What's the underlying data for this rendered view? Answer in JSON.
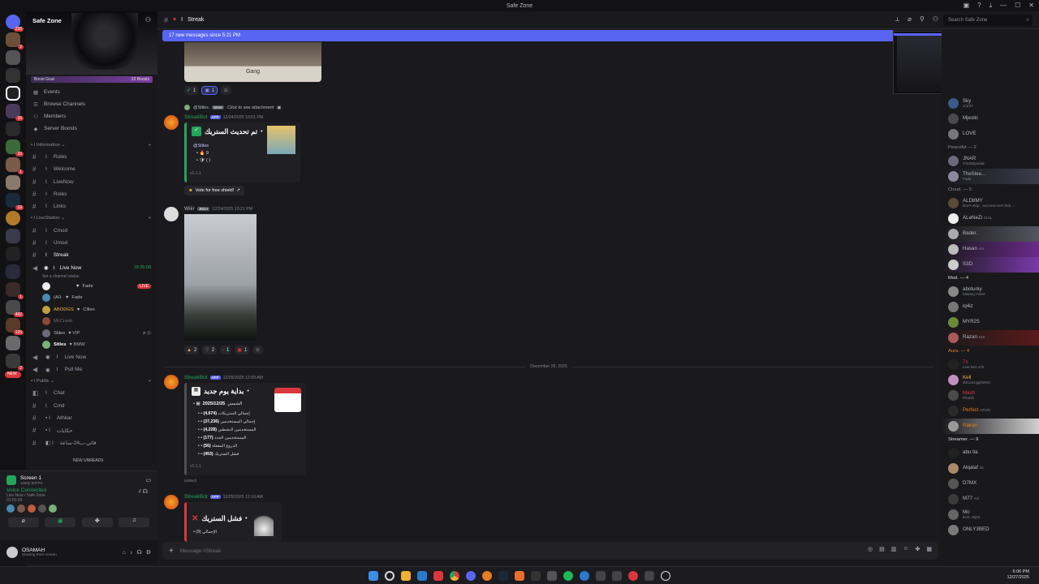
{
  "window": {
    "title": "Safe Zone"
  },
  "server": {
    "name": "Safe Zone",
    "boost_goal": "Boost Goal",
    "boost_count": "33 Boosts"
  },
  "rail_badges": [
    "238",
    "2",
    "16",
    "10",
    "1",
    "9",
    "19",
    "1",
    "492",
    "1",
    "126",
    "2",
    "NEW"
  ],
  "nav_items": [
    {
      "icon": "calendar-icon",
      "label": "Events"
    },
    {
      "icon": "browse-icon",
      "label": "Browse Channels"
    },
    {
      "icon": "members-icon",
      "label": "Members"
    },
    {
      "icon": "boost-icon",
      "label": "Server Boosts"
    }
  ],
  "categories": {
    "information": "Information",
    "livestation": "LiveStation",
    "public": "Public"
  },
  "info_channels": [
    "Rules",
    "Welcome",
    "LiveNow",
    "Roles",
    "Links"
  ],
  "live_channels": [
    "Cmod",
    "Umod",
    "Streak"
  ],
  "voice_live": {
    "name": "Live Now",
    "timer": "18:26:08",
    "status": "Set a channel status",
    "live_badge": "LIVE"
  },
  "voice_users": [
    "Fade",
    "Fade",
    "Clllen",
    "McCrash",
    "Stiles"
  ],
  "voice_users_names": [
    "ᅟ",
    "(A0-",
    "ABODGS",
    "Clllen",
    "McCrash"
  ],
  "voice_channels2": [
    "Live Now",
    "Pull Me"
  ],
  "public_channels": [
    "Chat",
    "Cmd",
    "Athkar",
    "حكايات",
    "قائي-ب24-ساعة"
  ],
  "new_unreads": "NEW UNREADS",
  "screen_share": {
    "title": "Screen 1",
    "sub": "1080p 60FPS"
  },
  "voice_connected": {
    "label": "Voice Connected",
    "channel": "Live Now / Safe Zone",
    "time": "01:50:39"
  },
  "user": {
    "name": "OSAMAH",
    "status": "Sharing their screen"
  },
  "header": {
    "channel": "Streak",
    "search_placeholder": "Search Safe Zone"
  },
  "new_messages_bar": "17 new messages since 5:21 PM",
  "messages": {
    "gang_caption": "Gang",
    "r1": [
      "1",
      "1"
    ],
    "reply_user": "@Stiles",
    "reply_tag": "BMW",
    "reply_text": "Click to see attachment",
    "streakbot": "StreakBot",
    "app_tag": "APP",
    "m1_time": "12/24/2025 10:01 PM",
    "m1_title": "تم تحديث الستريك",
    "m1_mention": "@Stiles",
    "m1_v1": "9",
    "m1_v2": "( )",
    "m1_ver": "v1.1.1",
    "vote": "Vote for free shield!",
    "wiiir": "Wiiir",
    "wiiir_tag": "JMLH",
    "wiiir_time": "12/24/2025 10:21 PM",
    "r2": [
      "2",
      "2",
      "1",
      "1"
    ],
    "date_divider": "December 25, 2025",
    "m2_time": "12/25/2025 12:00 AM",
    "m2_title": "بداية يوم جديد",
    "m2_date": "2025/12/25",
    "m2_date_label": "الشمس",
    "m2_lines": [
      {
        "v": "(4,674)",
        "t": "إجمالي الستريكات"
      },
      {
        "v": "(37,236)",
        "t": "إجمالي المستخدمين"
      },
      {
        "v": "(4,228)",
        "t": "المستخدمين النشطين"
      },
      {
        "v": "(177)",
        "t": "المستخدمين الجدد"
      },
      {
        "v": "(56)",
        "t": "الدروع المفعلة"
      },
      {
        "v": "(453)",
        "t": "فشل الستريك"
      }
    ],
    "m2_ver": "v1.1.1",
    "edited": "(edited)",
    "m3_time": "12/25/2025 12:10 AM",
    "m3_title": "فشل الستريك",
    "m3_line": "(9) الإجمالي"
  },
  "input_placeholder": "Message #Streak",
  "members": {
    "top": [
      {
        "name": "Sky",
        "sub": "1/1/3Y"
      },
      {
        "name": "Mjestic",
        "sub": ""
      },
      {
        "name": "LOVE",
        "sub": ""
      }
    ],
    "groups": [
      {
        "title": "Peaceful — 2",
        "list": [
          {
            "name": "JNAR",
            "sub": "Ghost&pedal"
          },
          {
            "name": "TheSlee...",
            "sub": "Fade"
          }
        ]
      },
      {
        "title": "Cloud. — 5",
        "list": [
          {
            "name": "ALD8MY",
            "sub": "Don't stop , success isn't that ..."
          },
          {
            "name": "ALeNeZi",
            "sub": "CHIL"
          },
          {
            "name": "Bader.",
            "sub": ""
          },
          {
            "name": "Hasan",
            "sub": "Azi"
          },
          {
            "name": "S3D",
            "sub": ""
          }
        ]
      },
      {
        "title": "Mod. — 4",
        "list": [
          {
            "name": "aboturky",
            "sub": "Making Fame"
          },
          {
            "name": "lq4iz",
            "sub": ""
          },
          {
            "name": "MYR25",
            "sub": ""
          },
          {
            "name": "Razan",
            "sub": "619"
          }
        ]
      },
      {
        "title": "Aura. — 4",
        "list": [
          {
            "name": "7s",
            "sub": "Live kick o7s"
          },
          {
            "name": "Kell",
            "sub": "discord.gg/WIXU"
          },
          {
            "name": "Mash",
            "sub": "Plomih"
          },
          {
            "name": "Perfect",
            "sub": "AFUN"
          },
          {
            "name": "Rakan",
            "sub": ""
          }
        ]
      },
      {
        "title": "Streamer. — 9",
        "list": [
          {
            "name": "abu tla",
            "sub": ""
          },
          {
            "name": "Alqalaf",
            "sub": "OL"
          },
          {
            "name": "D7MX",
            "sub": ""
          },
          {
            "name": "M77",
            "sub": "Azi"
          },
          {
            "name": "Mo",
            "sub": "kick: vsj23"
          },
          {
            "name": "ONLY3BED",
            "sub": ""
          }
        ]
      }
    ]
  },
  "clock": {
    "time": "6:06 PM",
    "date": "12/27/2025"
  },
  "colors": {
    "accent": "#5865f2",
    "live": "#da373c",
    "green": "#23a55a"
  }
}
